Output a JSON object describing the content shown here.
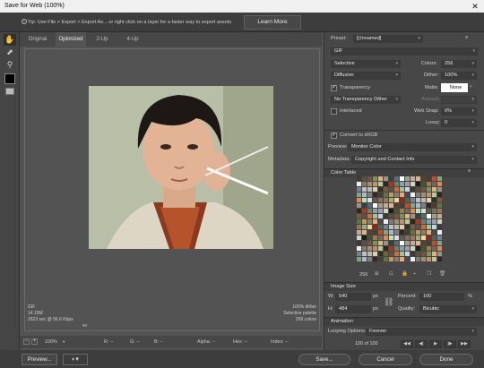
{
  "window": {
    "title": "Save for Web (100%)",
    "close_glyph": "✕"
  },
  "tip": {
    "text": "Tip: Use File > Export > Export As...  or right click on a layer for a faster way to export assets",
    "learn_more": "Learn More"
  },
  "tabs": [
    "Original",
    "Optimized",
    "2-Up",
    "4-Up"
  ],
  "image_info": {
    "left": [
      "GIF",
      "14.15M",
      "2623 sec @ 56.6 Kbps"
    ],
    "right": [
      "100% dither",
      "Selective palette",
      "256 colors"
    ]
  },
  "status": {
    "zoom": "100%",
    "r": "R: --",
    "g": "G: --",
    "b": "B: --",
    "alpha": "Alpha: --",
    "hex": "Hex: --",
    "index": "Index: --"
  },
  "settings": {
    "preset_label": "Preset:",
    "preset_value": "[Unnamed]",
    "format": "GIF",
    "reduction": "Selective",
    "colors_label": "Colors:",
    "colors_value": "256",
    "dither_algo": "Diffusion",
    "dither_label": "Dither:",
    "dither_value": "100%",
    "transparency": "Transparency",
    "matte_label": "Matte:",
    "matte_value": "None",
    "trans_dither": "No Transparency Dither",
    "amount_label": "Amount:",
    "interlaced": "Interlaced",
    "websnap_label": "Web Snap:",
    "websnap_value": "0%",
    "lossy_label": "Lossy:",
    "lossy_value": "0",
    "convert_srgb": "Convert to sRGB",
    "preview_label": "Preview:",
    "preview_value": "Monitor Color",
    "metadata_label": "Metadata:",
    "metadata_value": "Copyright and Contact Info"
  },
  "color_table": {
    "title": "Color Table",
    "count": "256"
  },
  "image_size": {
    "title": "Image Size",
    "w_label": "W:",
    "w_value": "540",
    "h_label": "H:",
    "h_value": "484",
    "unit": "px",
    "percent_label": "Percent:",
    "percent_value": "100",
    "percent_unit": "%",
    "quality_label": "Quality:",
    "quality_value": "Bicubic"
  },
  "animation": {
    "title": "Animation",
    "looping_label": "Looping Options:",
    "looping_value": "Forever",
    "frame": "100 of 100"
  },
  "buttons": {
    "preview": "Preview...",
    "save": "Save...",
    "cancel": "Cancel",
    "done": "Done"
  },
  "palette": [
    "#3c3a31",
    "#5b5b4e",
    "#7a7e6d",
    "#9aa18e",
    "#b6bca8",
    "#cfd3c4",
    "#2e2a26",
    "#5a4e42",
    "#826e5d",
    "#a48c78",
    "#c4a995",
    "#e2c9b7",
    "#1e1b18",
    "#4a3b30",
    "#6e5647",
    "#93775f",
    "#b89377",
    "#d9b39a",
    "#2a3420",
    "#445433",
    "#5f734a",
    "#7c9262",
    "#99af7b",
    "#b6c996",
    "#56412b",
    "#7a5c3c",
    "#9e7a4f",
    "#bd9867",
    "#d9b583",
    "#efd2a6",
    "#2b2826",
    "#423e3a",
    "#58534e",
    "#6e6862",
    "#847d76",
    "#9a928a",
    "#8a2a1f",
    "#a43a25",
    "#be4d2f",
    "#c96c3e",
    "#d98c58",
    "#e6ab78",
    "#31443b",
    "#4b6455",
    "#65846f",
    "#80a48a",
    "#9bc3a5",
    "#b7e0c1",
    "#454b55",
    "#5e6672",
    "#78818e",
    "#939cab",
    "#aeb7c7",
    "#c9d2e1",
    "#dcdcdc",
    "#eeeeee",
    "#ffffff",
    "#bfbfbf",
    "#9f9f9f",
    "#7f7f7f"
  ]
}
